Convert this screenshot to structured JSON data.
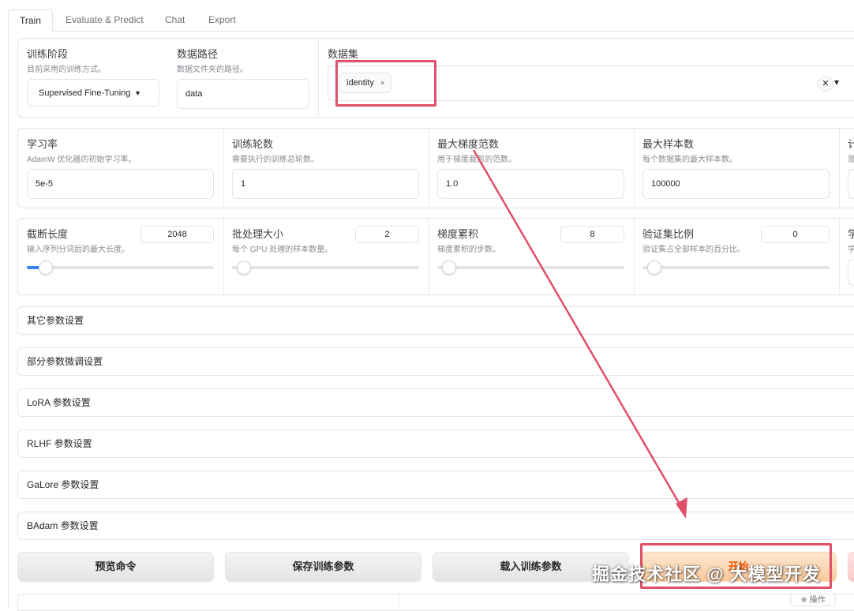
{
  "tabs": [
    "Train",
    "Evaluate & Predict",
    "Chat",
    "Export"
  ],
  "top": {
    "stage": {
      "label": "训练阶段",
      "info": "目前采用的训练方式。",
      "value": "Supervised Fine-Tuning"
    },
    "data_dir": {
      "label": "数据路径",
      "info": "数据文件夹的路径。",
      "value": "data"
    },
    "dataset": {
      "label": "数据集",
      "chip": "identity",
      "chip_remove": "×",
      "clear": "✕",
      "dropdown": "▾"
    }
  },
  "params": [
    {
      "label": "学习率",
      "info": "AdamW 优化器的初始学习率。",
      "value": "5e-5"
    },
    {
      "label": "训练轮数",
      "info": "需要执行的训练总轮数。",
      "value": "1"
    },
    {
      "label": "最大梯度范数",
      "info": "用于梯度裁剪的范数。",
      "value": "1.0"
    },
    {
      "label": "最大样本数",
      "info": "每个数据集的最大样本数。",
      "value": "100000"
    },
    {
      "label": "计",
      "info": "是",
      "value": ""
    }
  ],
  "sliders": [
    {
      "label": "截断长度",
      "info": "输入序列分词后的最大长度。",
      "value": "2048",
      "level": 0.04
    },
    {
      "label": "批处理大小",
      "info": "每个 GPU 处理的样本数量。",
      "value": "2",
      "level": 0.0
    },
    {
      "label": "梯度累积",
      "info": "梯度累积的步数。",
      "value": "8",
      "level": 0.0
    },
    {
      "label": "验证集比例",
      "info": "验证集占全部样本的百分比。",
      "value": "0",
      "level": 0.0
    },
    {
      "label": "学",
      "info": "学"
    }
  ],
  "accordions": [
    "其它参数设置",
    "部分参数微调设置",
    "LoRA 参数设置",
    "RLHF 参数设置",
    "GaLore 参数设置",
    "BAdam 参数设置"
  ],
  "buttons": {
    "preview": "预览命令",
    "save": "保存训练参数",
    "load": "载入训练参数",
    "start": "开始"
  },
  "bottom_fragment": "※ 操作",
  "watermark": "掘金技术社区 @ 大模型开发",
  "colors": {
    "highlight": "#e05068",
    "accent": "#ea580c",
    "slider": "#3b82f6"
  }
}
